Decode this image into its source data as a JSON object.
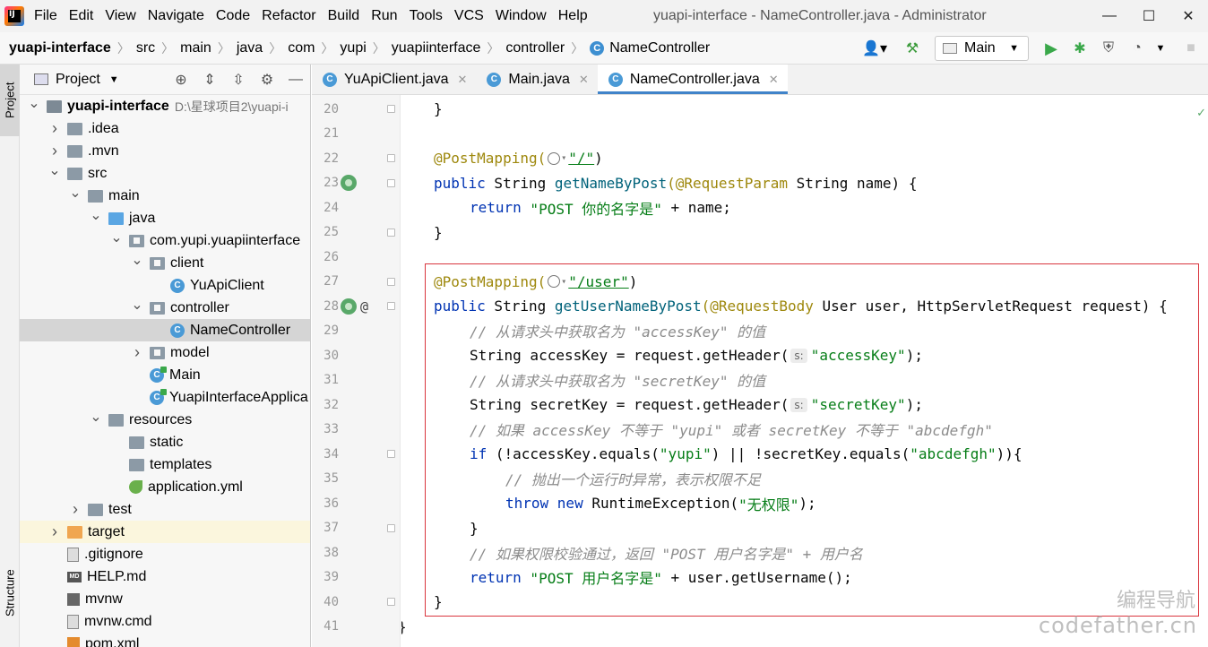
{
  "menu": {
    "items": [
      "File",
      "Edit",
      "View",
      "Navigate",
      "Code",
      "Refactor",
      "Build",
      "Run",
      "Tools",
      "VCS",
      "Window",
      "Help"
    ],
    "window_title": "yuapi-interface - NameController.java - Administrator"
  },
  "breadcrumb": [
    "yuapi-interface",
    "src",
    "main",
    "java",
    "com",
    "yupi",
    "yuapiinterface",
    "controller",
    "NameController"
  ],
  "toolbar": {
    "run_config": "Main"
  },
  "project": {
    "title": "Project",
    "tree": [
      {
        "label": "yuapi-interface",
        "path": "D:\\星球项目2\\yuapi-i",
        "depth": 0,
        "arrow": "▾",
        "icon": "module",
        "bold": true
      },
      {
        "label": ".idea",
        "depth": 1,
        "arrow": "▸",
        "icon": "folder"
      },
      {
        "label": ".mvn",
        "depth": 1,
        "arrow": "▸",
        "icon": "folder"
      },
      {
        "label": "src",
        "depth": 1,
        "arrow": "▾",
        "icon": "folder"
      },
      {
        "label": "main",
        "depth": 2,
        "arrow": "▾",
        "icon": "folder"
      },
      {
        "label": "java",
        "depth": 3,
        "arrow": "▾",
        "icon": "folder-blue"
      },
      {
        "label": "com.yupi.yuapiinterface",
        "depth": 4,
        "arrow": "▾",
        "icon": "pkg"
      },
      {
        "label": "client",
        "depth": 5,
        "arrow": "▾",
        "icon": "pkg"
      },
      {
        "label": "YuApiClient",
        "depth": 6,
        "arrow": "",
        "icon": "cls"
      },
      {
        "label": "controller",
        "depth": 5,
        "arrow": "▾",
        "icon": "pkg"
      },
      {
        "label": "NameController",
        "depth": 6,
        "arrow": "",
        "icon": "cls",
        "selected": true
      },
      {
        "label": "model",
        "depth": 5,
        "arrow": "▸",
        "icon": "pkg"
      },
      {
        "label": "Main",
        "depth": 5,
        "arrow": "",
        "icon": "cls-run"
      },
      {
        "label": "YuapiInterfaceApplica",
        "depth": 5,
        "arrow": "",
        "icon": "cls-run"
      },
      {
        "label": "resources",
        "depth": 3,
        "arrow": "▾",
        "icon": "folder-res"
      },
      {
        "label": "static",
        "depth": 4,
        "arrow": "",
        "icon": "folder"
      },
      {
        "label": "templates",
        "depth": 4,
        "arrow": "",
        "icon": "folder"
      },
      {
        "label": "application.yml",
        "depth": 4,
        "arrow": "",
        "icon": "yml"
      },
      {
        "label": "test",
        "depth": 2,
        "arrow": "▸",
        "icon": "folder"
      },
      {
        "label": "target",
        "depth": 1,
        "arrow": "▸",
        "icon": "folder-orange",
        "highlight": true
      },
      {
        "label": ".gitignore",
        "depth": 1,
        "arrow": "",
        "icon": "file"
      },
      {
        "label": "HELP.md",
        "depth": 1,
        "arrow": "",
        "icon": "md"
      },
      {
        "label": "mvnw",
        "depth": 1,
        "arrow": "",
        "icon": "exe"
      },
      {
        "label": "mvnw.cmd",
        "depth": 1,
        "arrow": "",
        "icon": "file"
      },
      {
        "label": "pom.xml",
        "depth": 1,
        "arrow": "",
        "icon": "xml"
      }
    ]
  },
  "side_tabs": {
    "project": "Project",
    "structure": "Structure"
  },
  "editor": {
    "tabs": [
      {
        "label": "YuApiClient.java",
        "active": false
      },
      {
        "label": "Main.java",
        "active": false
      },
      {
        "label": "NameController.java",
        "active": true
      }
    ],
    "line_numbers": [
      "20",
      "21",
      "22",
      "23",
      "24",
      "25",
      "26",
      "27",
      "28",
      "29",
      "30",
      "31",
      "32",
      "33",
      "34",
      "35",
      "36",
      "37",
      "38",
      "39",
      "40",
      "41"
    ],
    "hint_label": "s:",
    "code": {
      "l20": "}",
      "l22_ann": "@PostMapping(",
      "l22_str": "\"/\"",
      "l22_end": ")",
      "l23_kw": "public",
      "l23_type": " String ",
      "l23_fn": "getNameByPost",
      "l23_ann": "(@RequestParam",
      "l23_rest": " String name) {",
      "l24_kw": "return",
      "l24_str": " \"POST 你的名字是\"",
      "l24_rest": " + name;",
      "l25": "}",
      "l27_ann": "@PostMapping(",
      "l27_str": "\"/user\"",
      "l27_end": ")",
      "l28_kw": "public",
      "l28_type": " String ",
      "l28_fn": "getUserNameByPost",
      "l28_ann": "(@RequestBody",
      "l28_rest": " User user, HttpServletRequest request) {",
      "l29": "// 从请求头中获取名为 \"accessKey\" 的值",
      "l30_a": "String accessKey = request.getHeader(",
      "l30_str": "\"accessKey\"",
      "l30_end": ");",
      "l31": "// 从请求头中获取名为 \"secretKey\" 的值",
      "l32_a": "String secretKey = request.getHeader(",
      "l32_str": "\"secretKey\"",
      "l32_end": ");",
      "l33": "// 如果 accessKey 不等于 \"yupi\" 或者 secretKey 不等于 \"abcdefgh\"",
      "l34_kw": "if",
      "l34_a": " (!accessKey.equals(",
      "l34_s1": "\"yupi\"",
      "l34_b": ") || !secretKey.equals(",
      "l34_s2": "\"abcdefgh\"",
      "l34_c": ")){",
      "l35": "// 抛出一个运行时异常，表示权限不足",
      "l36_kw": "throw new",
      "l36_a": " RuntimeException(",
      "l36_str": "\"无权限\"",
      "l36_end": ");",
      "l37": "}",
      "l38": "// 如果权限校验通过，返回 \"POST 用户名字是\" + 用户名",
      "l39_kw": "return",
      "l39_str": " \"POST 用户名字是\"",
      "l39_rest": " + user.getUsername();",
      "l40": "}",
      "l41": "}"
    }
  },
  "watermark": {
    "cn": "编程导航",
    "en": "codefather.cn"
  }
}
